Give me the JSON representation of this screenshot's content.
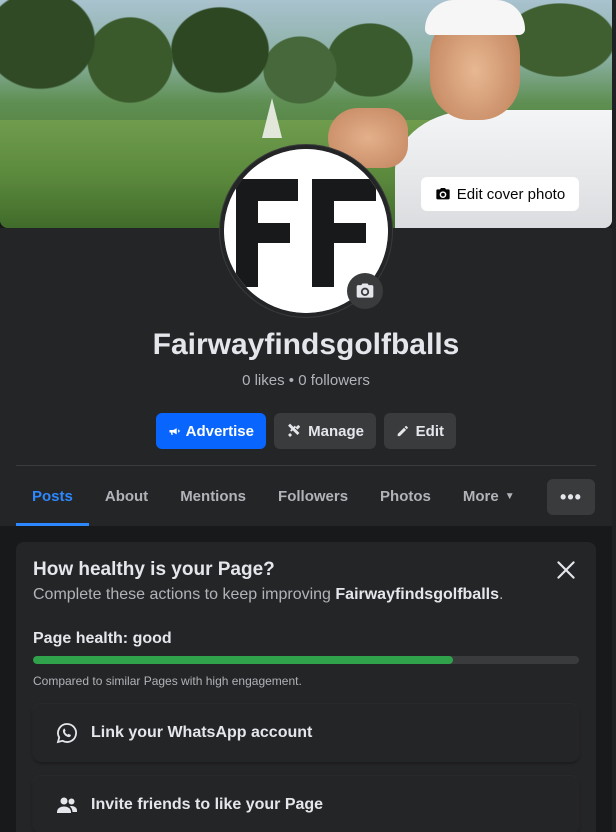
{
  "cover": {
    "edit_label": "Edit cover photo"
  },
  "profile": {
    "name": "Fairwayfindsgolfballs",
    "stats": "0 likes • 0 followers"
  },
  "actions": {
    "advertise": "Advertise",
    "manage": "Manage",
    "edit": "Edit"
  },
  "tabs": [
    {
      "label": "Posts",
      "active": true
    },
    {
      "label": "About"
    },
    {
      "label": "Mentions"
    },
    {
      "label": "Followers"
    },
    {
      "label": "Photos"
    },
    {
      "label": "More"
    }
  ],
  "more_menu_glyph": "•••",
  "health_card": {
    "title": "How healthy is your Page?",
    "subtitle_prefix": "Complete these actions to keep improving ",
    "subtitle_name": "Fairwayfindsgolfballs",
    "subtitle_suffix": ".",
    "health_label": "Page health: good",
    "health_fraction": 0.77,
    "compare_text": "Compared to similar Pages with high engagement.",
    "tasks": [
      {
        "label": "Link your WhatsApp account",
        "icon": "whatsapp-icon"
      },
      {
        "label": "Invite friends to like your Page",
        "icon": "friends-icon"
      }
    ]
  },
  "colors": {
    "primary": "#0866ff",
    "active_tab": "#2d88ff",
    "health_bar": "#31a24c",
    "background": "#18191a",
    "surface": "#242526"
  }
}
